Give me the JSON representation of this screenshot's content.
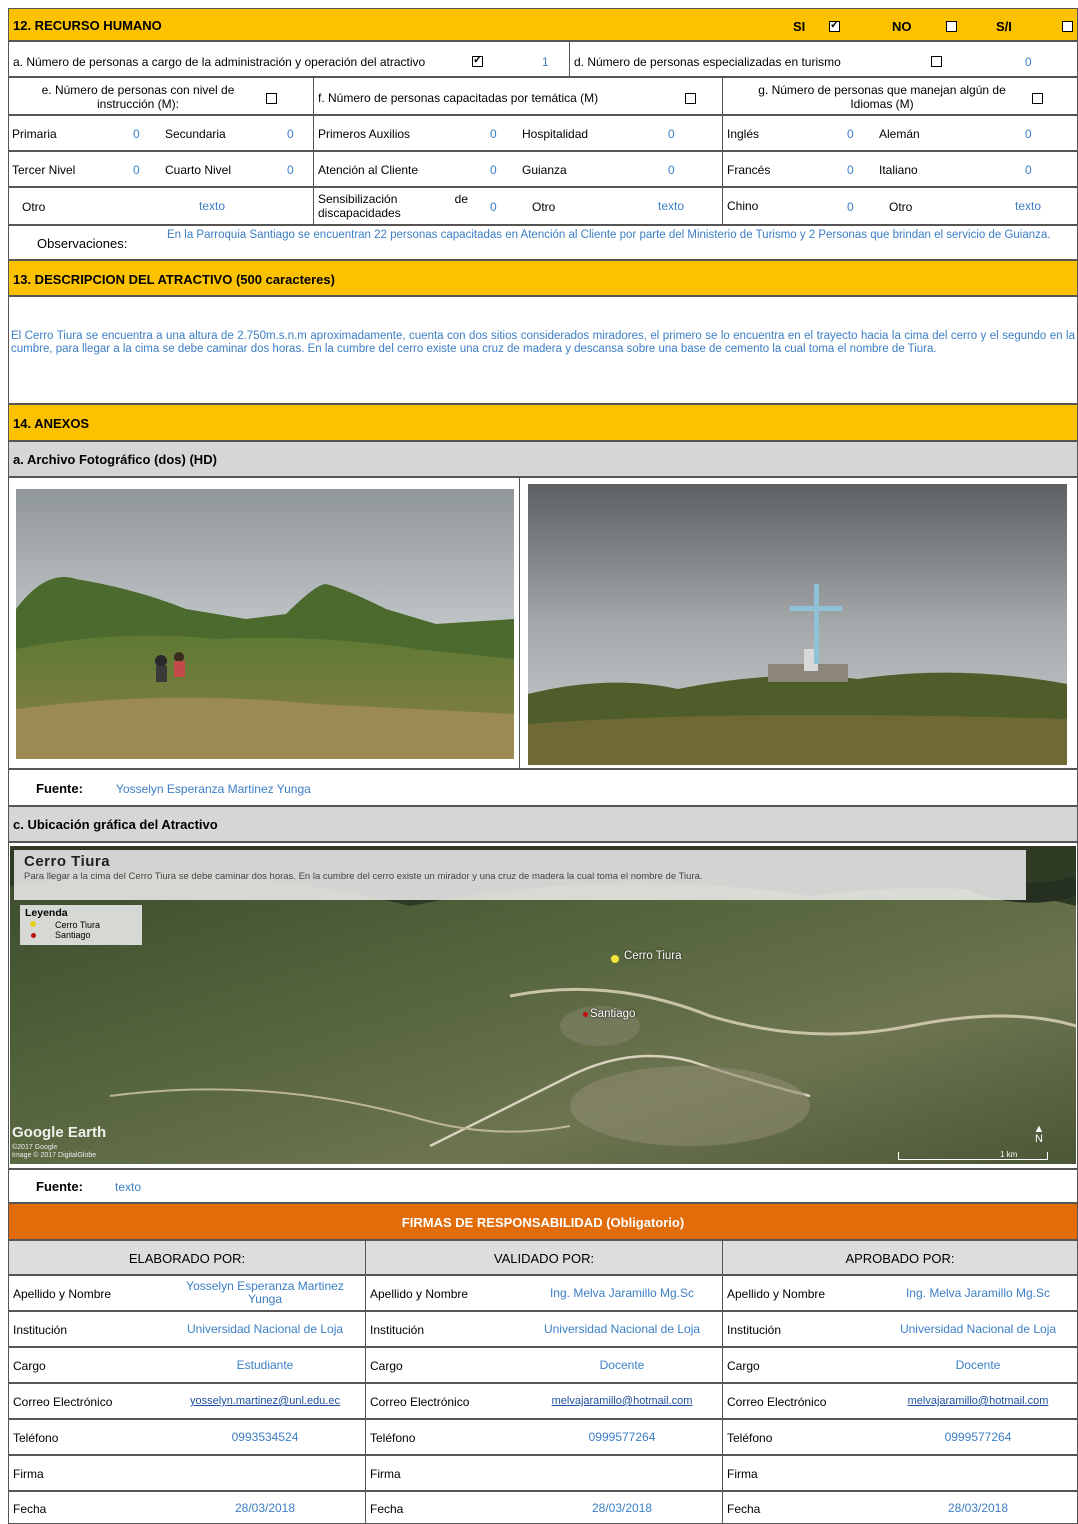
{
  "s12": {
    "title": "12. RECURSO HUMANO",
    "si_label": "SI",
    "no_label": "NO",
    "si_na_label": "S/I",
    "row_a_label": "a. Número de personas a cargo de la administración y operación del atractivo",
    "row_a_value": "1",
    "row_d_label": "d. Número de personas especializadas en turismo",
    "row_d_value": "0",
    "e_label": "e. Número de personas con nivel de instrucción (M):",
    "f_label": "f. Número de personas capacitadas por temática (M)",
    "g_label": "g. Número de personas que manejan algún de Idiomas (M)",
    "grid": [
      [
        "Primaria",
        "0",
        "Secundaria",
        "0",
        "Primeros Auxilios",
        "0",
        "Hospitalidad",
        "0",
        "Inglés",
        "0",
        "Alemán",
        "0"
      ],
      [
        "Tercer Nivel",
        "0",
        "Cuarto Nivel",
        "0",
        "Atención al Cliente",
        "0",
        "Guianza",
        "0",
        "Francés",
        "0",
        "Italiano",
        "0"
      ],
      [
        "Otro",
        "texto",
        "",
        "",
        "Sensibilización de discapacidades",
        "0",
        "Otro",
        "texto",
        "Chino",
        "0",
        "Otro",
        "texto"
      ]
    ],
    "obs_label": "Observaciones:",
    "obs_text": "En la Parroquia Santiago se encuentran 22 personas capacitadas en Atención al Cliente por parte del Ministerio de Turismo y 2 Personas que brindan el servicio de Guianza."
  },
  "s13": {
    "title": "13. DESCRIPCION DEL ATRACTIVO (500 caracteres)",
    "text": "El Cerro Tiura se encuentra a una altura de 2.750m.s.n.m aproximadamente, cuenta con dos sitios considerados miradores, el primero se lo encuentra en el trayecto hacia la cima del cerro y el segundo en la cumbre, para llegar a la cima se debe caminar dos horas. En la cumbre del cerro existe una cruz de madera y descansa sobre una base de cemento la cual toma el nombre de Tiura."
  },
  "s14": {
    "title": "14. ANEXOS",
    "photo_title": "a. Archivo Fotográfico (dos) (HD)",
    "fuente_label": "Fuente:",
    "fuente_photo": "Yosselyn Esperanza Martinez Yunga",
    "map_title": "c. Ubicación gráfica del Atractivo",
    "map_heading": "Cerro Tiura",
    "map_desc": "Para llegar a la cima del Cerro Tiura se debe caminar dos horas. En la cumbre del cerro existe un mirador y una cruz de madera la cual toma el nombre de Tiura.",
    "legend_title": "Leyenda",
    "legend_items": [
      "Cerro Tiura",
      "Santiago"
    ],
    "map_label_tiura": "Cerro Tiura",
    "map_label_santiago": "Santiago",
    "google_earth": "Google Earth",
    "copyright": "©2017 Google\nImage © 2017 DigitalGlobe",
    "scale": "1 km",
    "north": "N",
    "fuente_map": "texto"
  },
  "firmas": {
    "title": "FIRMAS DE RESPONSABILIDAD (Obligatorio)",
    "columns": [
      {
        "heading": "ELABORADO POR:",
        "apellido": "Yosselyn Esperanza Martinez Yunga",
        "institucion": "Universidad Nacional de Loja",
        "cargo": "Estudiante",
        "correo": "yosselyn.martinez@unl.edu.ec",
        "telefono": "0993534524",
        "firma": "",
        "fecha": "28/03/2018"
      },
      {
        "heading": "VALIDADO POR:",
        "apellido": "Ing. Melva Jaramillo Mg.Sc",
        "institucion": "Universidad Nacional de Loja",
        "cargo": "Docente",
        "correo": "melvajaramillo@hotmail.com",
        "telefono": "0999577264",
        "firma": "",
        "fecha": "28/03/2018"
      },
      {
        "heading": "APROBADO POR:",
        "apellido": "Ing. Melva Jaramillo Mg.Sc",
        "institucion": "Universidad Nacional de Loja",
        "cargo": "Docente",
        "correo": "melvajaramillo@hotmail.com",
        "telefono": "0999577264",
        "firma": "",
        "fecha": "28/03/2018"
      }
    ],
    "row_labels": {
      "apellido": "Apellido y Nombre",
      "institucion": "Institución",
      "cargo": "Cargo",
      "correo": "Correo Electrónico",
      "telefono": "Teléfono",
      "firma": "Firma",
      "fecha": "Fecha"
    }
  }
}
